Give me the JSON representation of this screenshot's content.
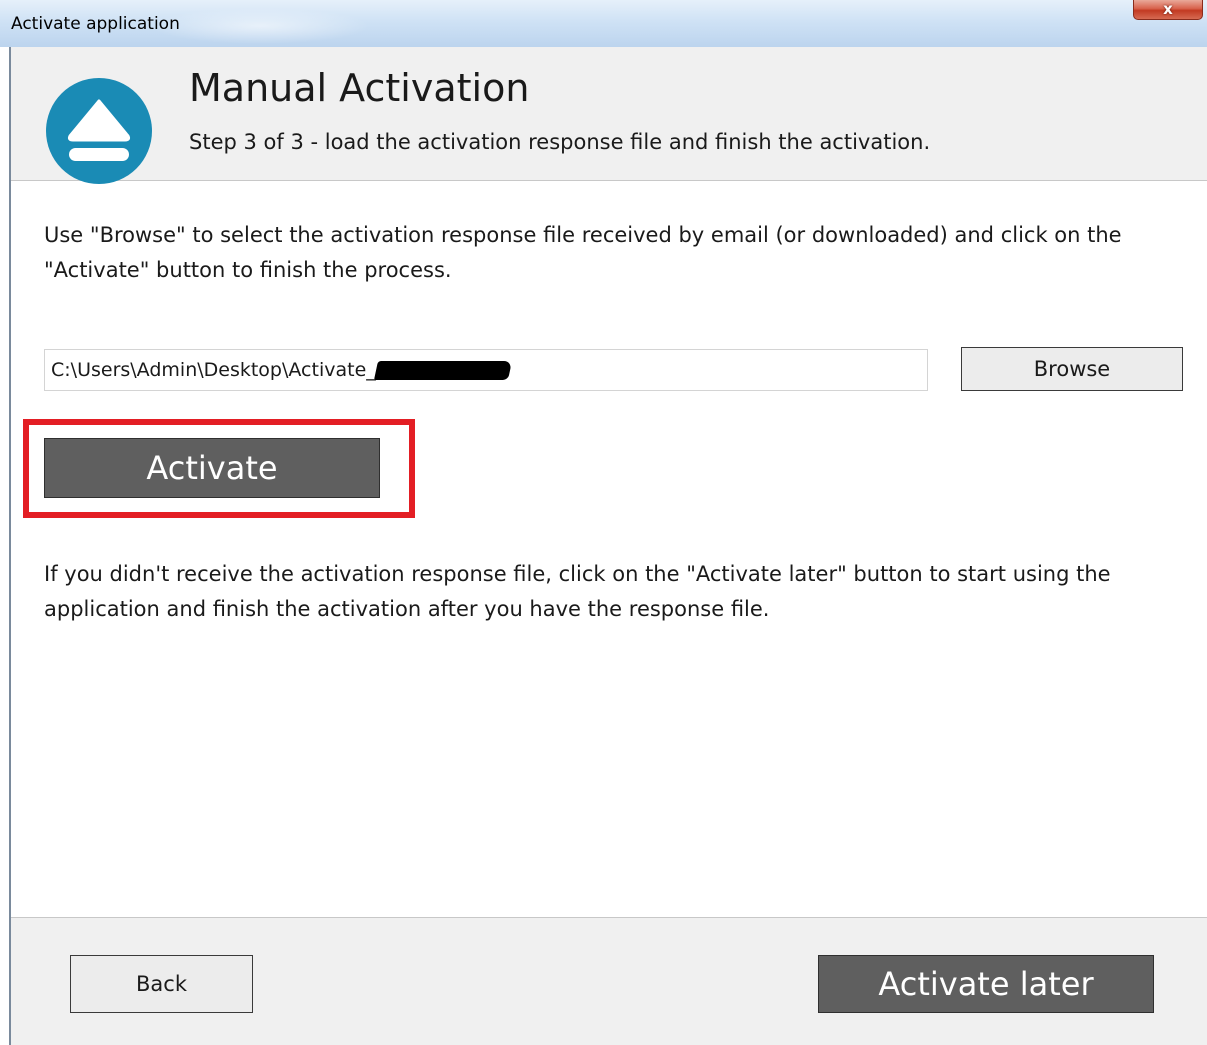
{
  "window": {
    "title": "Activate application",
    "close_glyph": "x"
  },
  "header": {
    "title": "Manual Activation",
    "subtitle": "Step 3 of 3 - load the activation response file and finish the activation.",
    "logo_icon": "eject-icon"
  },
  "content": {
    "instructions": "Use \"Browse\" to select the activation response file received by email (or downloaded) and click on the \"Activate\" button to finish the process.",
    "file_path": "C:\\Users\\Admin\\Desktop\\Activate_",
    "browse_label": "Browse",
    "activate_label": "Activate",
    "note": "If you didn't receive the activation response file, click on the \"Activate later\" button to start using the application and finish the activation after you have the response file."
  },
  "footer": {
    "back_label": "Back",
    "activate_later_label": "Activate later"
  },
  "colors": {
    "accent": "#1a8bb5",
    "highlight": "#e31e24",
    "dark_button": "#5f5f5f"
  }
}
